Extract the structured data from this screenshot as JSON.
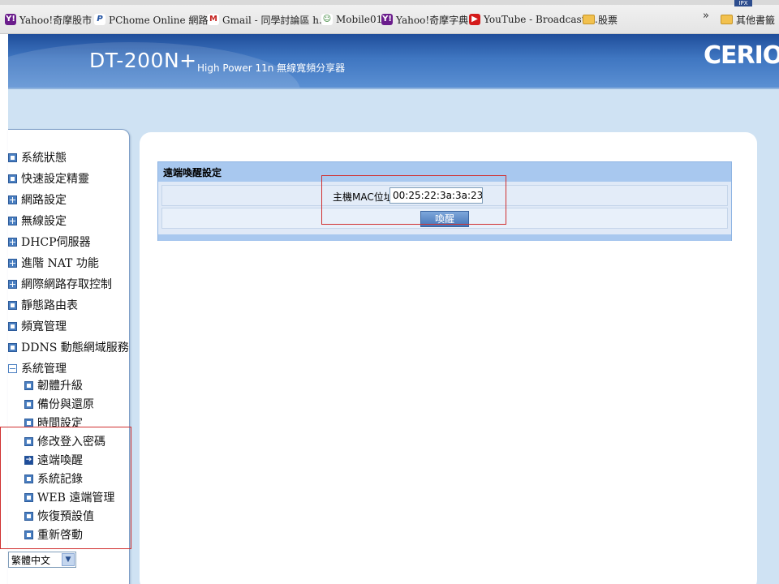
{
  "bookmarks": [
    {
      "label": "Yahoo!奇摩股市",
      "icon": "yahoo-icon"
    },
    {
      "label": "PChome Online 網路...",
      "icon": "pchome-icon"
    },
    {
      "label": "Gmail - 同學討論區 h...",
      "icon": "gmail-icon"
    },
    {
      "label": "Mobile01",
      "icon": "mobile01-icon"
    },
    {
      "label": "Yahoo!奇摩字典",
      "icon": "yahoo-icon"
    },
    {
      "label": "YouTube - Broadcast ...",
      "icon": "youtube-icon"
    },
    {
      "label": "股票",
      "icon": "folder-icon"
    }
  ],
  "bookmarks_more": "»",
  "other_bookmarks": "其他書籤",
  "ipx_badge": "IPX",
  "header": {
    "product": "DT-200N+",
    "subtitle": "High Power 11n 無線寬頻分享器",
    "brand": "CERIO"
  },
  "sidebar": {
    "items": [
      {
        "label": "系統狀態",
        "icon": "square-icon"
      },
      {
        "label": "快速設定精靈",
        "icon": "square-icon"
      },
      {
        "label": "網路設定",
        "icon": "expand-plus-icon"
      },
      {
        "label": "無線設定",
        "icon": "expand-plus-icon"
      },
      {
        "label": "DHCP伺服器",
        "icon": "expand-plus-icon"
      },
      {
        "label": "進階 NAT 功能",
        "icon": "expand-plus-icon"
      },
      {
        "label": "網際網路存取控制",
        "icon": "expand-plus-icon"
      },
      {
        "label": "靜態路由表",
        "icon": "square-icon"
      },
      {
        "label": "頻寬管理",
        "icon": "square-icon"
      },
      {
        "label": "DDNS 動態網域服務",
        "icon": "square-icon"
      },
      {
        "label": "系統管理",
        "icon": "collapse-minus-icon"
      }
    ],
    "subitems": [
      {
        "label": "韌體升級",
        "icon": "square-icon"
      },
      {
        "label": "備份與還原",
        "icon": "square-icon"
      },
      {
        "label": "時間設定",
        "icon": "square-icon"
      },
      {
        "label": "修改登入密碼",
        "icon": "square-icon"
      },
      {
        "label": "遠端喚醒",
        "icon": "arrow-right-icon"
      },
      {
        "label": "系統記錄",
        "icon": "square-icon"
      },
      {
        "label": "WEB 遠端管理",
        "icon": "square-icon"
      },
      {
        "label": "恢復預設值",
        "icon": "square-icon"
      },
      {
        "label": "重新啓動",
        "icon": "square-icon"
      }
    ],
    "language": "繁體中文",
    "language_arrow": "▼"
  },
  "form": {
    "title": "遠端喚醒設定",
    "mac_label": "主機MAC位址:",
    "mac_value": "00:25:22:3a:3a:23",
    "wake_button": "喚醒"
  },
  "colors": {
    "header_blue": "#1f4d9a",
    "page_bg": "#cfe2f3",
    "highlight_red": "#d03030"
  }
}
